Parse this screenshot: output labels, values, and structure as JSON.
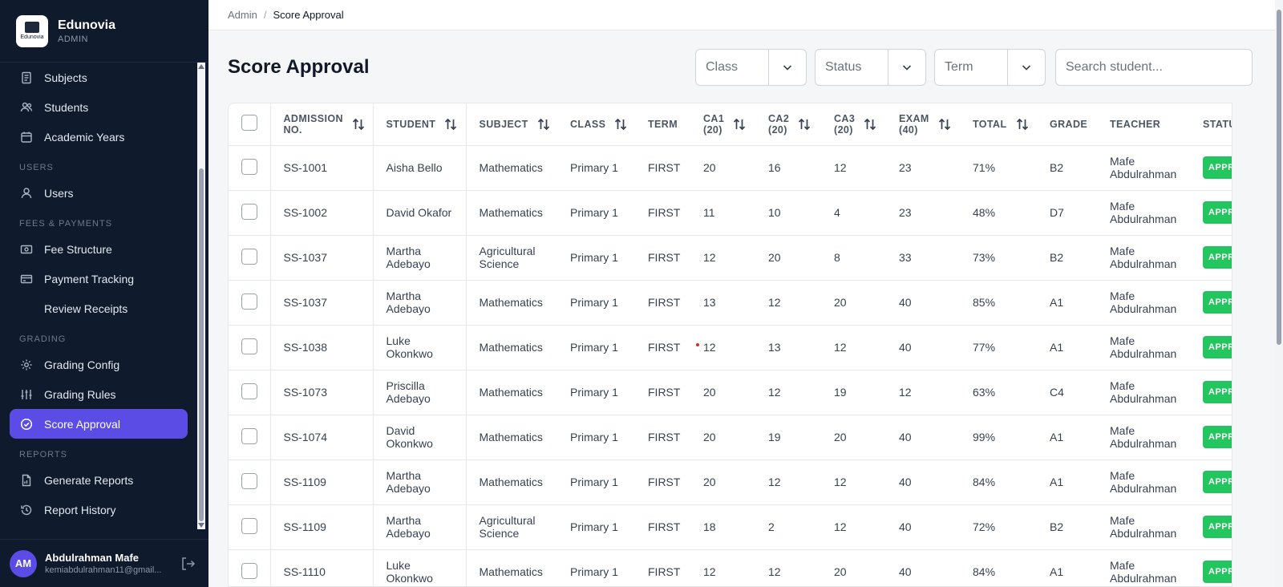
{
  "brand": {
    "name": "Edunovia",
    "role": "ADMIN",
    "logo_text": "Edunovia"
  },
  "sidebar": {
    "items": [
      {
        "label": "Subjects",
        "icon": "book-icon"
      },
      {
        "label": "Students",
        "icon": "users-icon"
      },
      {
        "label": "Academic Years",
        "icon": "calendar-icon"
      }
    ],
    "sections": [
      {
        "title": "USERS",
        "items": [
          {
            "label": "Users",
            "icon": "user-icon"
          }
        ]
      },
      {
        "title": "FEES & PAYMENTS",
        "items": [
          {
            "label": "Fee Structure",
            "icon": "banknote-icon"
          },
          {
            "label": "Payment Tracking",
            "icon": "credit-card-icon"
          },
          {
            "label": "Review Receipts",
            "icon": ""
          }
        ]
      },
      {
        "title": "GRADING",
        "items": [
          {
            "label": "Grading Config",
            "icon": "gear-icon"
          },
          {
            "label": "Grading Rules",
            "icon": "sliders-icon"
          },
          {
            "label": "Score Approval",
            "icon": "check-circle-icon",
            "active": true
          }
        ]
      },
      {
        "title": "REPORTS",
        "items": [
          {
            "label": "Generate Reports",
            "icon": "file-chart-icon"
          },
          {
            "label": "Report History",
            "icon": "history-icon"
          }
        ]
      }
    ]
  },
  "user": {
    "initials": "AM",
    "name": "Abdulrahman Mafe",
    "email": "kemiabdulrahman11@gmail..."
  },
  "breadcrumb": {
    "root": "Admin",
    "separator": "/",
    "current": "Score Approval"
  },
  "page": {
    "title": "Score Approval",
    "filters": [
      {
        "label": "Class"
      },
      {
        "label": "Status"
      },
      {
        "label": "Term"
      }
    ],
    "search_placeholder": "Search student..."
  },
  "table": {
    "columns": [
      {
        "key": "admission",
        "label": "ADMISSION NO.",
        "sortable": true
      },
      {
        "key": "student",
        "label": "STUDENT",
        "sortable": true
      },
      {
        "key": "subject",
        "label": "SUBJECT",
        "sortable": true
      },
      {
        "key": "class",
        "label": "CLASS",
        "sortable": true
      },
      {
        "key": "term",
        "label": "TERM",
        "sortable": false
      },
      {
        "key": "ca1",
        "label": "CA1 (20)",
        "sortable": true
      },
      {
        "key": "ca2",
        "label": "CA2 (20)",
        "sortable": true
      },
      {
        "key": "ca3",
        "label": "CA3 (20)",
        "sortable": true
      },
      {
        "key": "exam",
        "label": "EXAM (40)",
        "sortable": true
      },
      {
        "key": "total",
        "label": "TOTAL",
        "sortable": true
      },
      {
        "key": "grade",
        "label": "GRADE",
        "sortable": false
      },
      {
        "key": "teacher",
        "label": "TEACHER",
        "sortable": false
      },
      {
        "key": "status",
        "label": "STATUS",
        "sortable": false
      }
    ],
    "rows": [
      {
        "admission": "SS-1001",
        "student": "Aisha Bello",
        "subject": "Mathematics",
        "class": "Primary 1",
        "term": "FIRST",
        "ca1": "20",
        "ca2": "16",
        "ca3": "12",
        "exam": "23",
        "total": "71%",
        "grade": "B2",
        "teacher": "Mafe Abdulrahman",
        "status": "APPROVED"
      },
      {
        "admission": "SS-1002",
        "student": "David Okafor",
        "subject": "Mathematics",
        "class": "Primary 1",
        "term": "FIRST",
        "ca1": "11",
        "ca2": "10",
        "ca3": "4",
        "exam": "23",
        "total": "48%",
        "grade": "D7",
        "teacher": "Mafe Abdulrahman",
        "status": "APPROVED"
      },
      {
        "admission": "SS-1037",
        "student": "Martha Adebayo",
        "subject": "Agricultural Science",
        "class": "Primary 1",
        "term": "FIRST",
        "ca1": "12",
        "ca2": "20",
        "ca3": "8",
        "exam": "33",
        "total": "73%",
        "grade": "B2",
        "teacher": "Mafe Abdulrahman",
        "status": "APPROVED"
      },
      {
        "admission": "SS-1037",
        "student": "Martha Adebayo",
        "subject": "Mathematics",
        "class": "Primary 1",
        "term": "FIRST",
        "ca1": "13",
        "ca2": "12",
        "ca3": "20",
        "exam": "40",
        "total": "85%",
        "grade": "A1",
        "teacher": "Mafe Abdulrahman",
        "status": "APPROVED"
      },
      {
        "admission": "SS-1038",
        "student": "Luke Okonkwo",
        "subject": "Mathematics",
        "class": "Primary 1",
        "term": "FIRST",
        "ca1": "12",
        "ca2": "13",
        "ca3": "12",
        "exam": "40",
        "total": "77%",
        "grade": "A1",
        "teacher": "Mafe Abdulrahman",
        "status": "APPROVED",
        "marker": true
      },
      {
        "admission": "SS-1073",
        "student": "Priscilla Adebayo",
        "subject": "Mathematics",
        "class": "Primary 1",
        "term": "FIRST",
        "ca1": "20",
        "ca2": "12",
        "ca3": "19",
        "exam": "12",
        "total": "63%",
        "grade": "C4",
        "teacher": "Mafe Abdulrahman",
        "status": "APPROVED"
      },
      {
        "admission": "SS-1074",
        "student": "David Okonkwo",
        "subject": "Mathematics",
        "class": "Primary 1",
        "term": "FIRST",
        "ca1": "20",
        "ca2": "19",
        "ca3": "20",
        "exam": "40",
        "total": "99%",
        "grade": "A1",
        "teacher": "Mafe Abdulrahman",
        "status": "APPROVED"
      },
      {
        "admission": "SS-1109",
        "student": "Martha Adebayo",
        "subject": "Mathematics",
        "class": "Primary 1",
        "term": "FIRST",
        "ca1": "20",
        "ca2": "12",
        "ca3": "12",
        "exam": "40",
        "total": "84%",
        "grade": "A1",
        "teacher": "Mafe Abdulrahman",
        "status": "APPROVED"
      },
      {
        "admission": "SS-1109",
        "student": "Martha Adebayo",
        "subject": "Agricultural Science",
        "class": "Primary 1",
        "term": "FIRST",
        "ca1": "18",
        "ca2": "2",
        "ca3": "12",
        "exam": "40",
        "total": "72%",
        "grade": "B2",
        "teacher": "Mafe Abdulrahman",
        "status": "APPROVED"
      },
      {
        "admission": "SS-1110",
        "student": "Luke Okonkwo",
        "subject": "Mathematics",
        "class": "Primary 1",
        "term": "FIRST",
        "ca1": "12",
        "ca2": "12",
        "ca3": "20",
        "exam": "40",
        "total": "84%",
        "grade": "A1",
        "teacher": "Mafe Abdulrahman",
        "status": "APPROVED"
      }
    ]
  },
  "colors": {
    "sidebar_bg": "#0f1b2d",
    "accent": "#5b4ce6",
    "approved": "#22c55e"
  }
}
